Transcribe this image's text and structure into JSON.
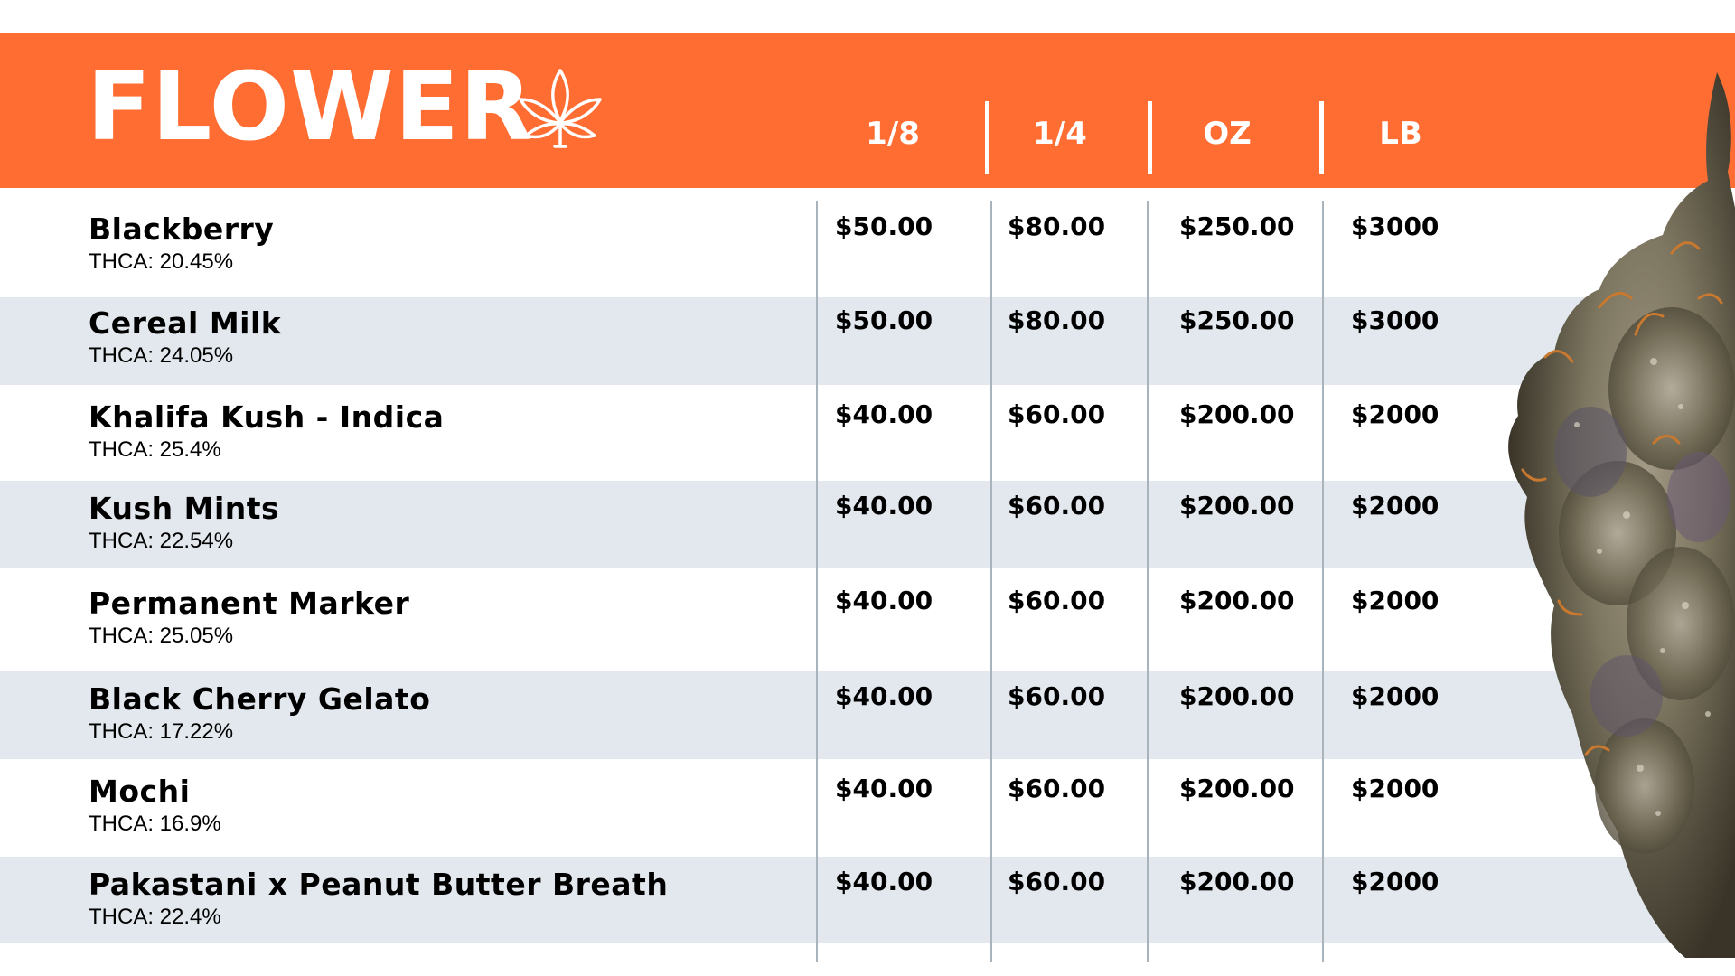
{
  "header": {
    "title": "FLOWER",
    "icon": "cannabis-leaf-icon",
    "columns": [
      "1/8",
      "1/4",
      "OZ",
      "LB"
    ]
  },
  "colors": {
    "header_bg": "#ff6d33",
    "row_shade": "#e2e8ed",
    "grid_line": "#a9b3bb"
  },
  "products": [
    {
      "name": "Blackberry",
      "thca": "THCA: 20.45%",
      "prices": [
        "$50.00",
        "$80.00",
        "$250.00",
        "$3000"
      ]
    },
    {
      "name": "Cereal Milk",
      "thca": "THCA: 24.05%",
      "prices": [
        "$50.00",
        "$80.00",
        "$250.00",
        "$3000"
      ]
    },
    {
      "name": "Khalifa Kush - Indica",
      "thca": "THCA: 25.4%",
      "prices": [
        "$40.00",
        "$60.00",
        "$200.00",
        "$2000"
      ]
    },
    {
      "name": "Kush Mints",
      "thca": "THCA: 22.54%",
      "prices": [
        "$40.00",
        "$60.00",
        "$200.00",
        "$2000"
      ]
    },
    {
      "name": "Permanent Marker",
      "thca": "THCA: 25.05%",
      "prices": [
        "$40.00",
        "$60.00",
        "$200.00",
        "$2000"
      ]
    },
    {
      "name": "Black Cherry Gelato",
      "thca": "THCA: 17.22%",
      "prices": [
        "$40.00",
        "$60.00",
        "$200.00",
        "$2000"
      ]
    },
    {
      "name": "Mochi",
      "thca": "THCA: 16.9%",
      "prices": [
        "$40.00",
        "$60.00",
        "$200.00",
        "$2000"
      ]
    },
    {
      "name": "Pakastani x Peanut Butter Breath",
      "thca": "THCA: 22.4%",
      "prices": [
        "$40.00",
        "$60.00",
        "$200.00",
        "$2000"
      ]
    }
  ],
  "image": {
    "icon": "cannabis-bud-image"
  }
}
